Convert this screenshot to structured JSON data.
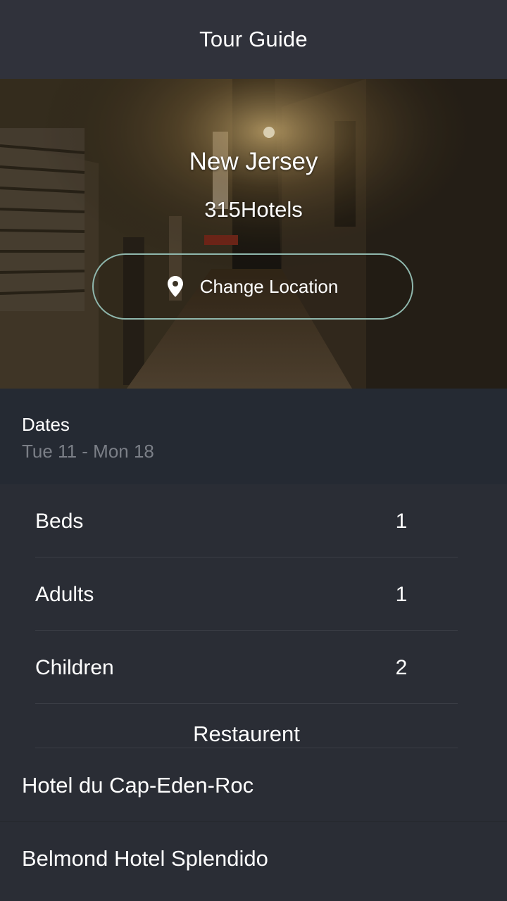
{
  "app_bar": {
    "title": "Tour Guide"
  },
  "hero": {
    "location": "New Jersey",
    "hotel_count": "315Hotels",
    "change_location_label": "Change Location",
    "button_border_color": "#8fb7ad",
    "pin_icon": "map-pin-icon"
  },
  "dates": {
    "label": "Dates",
    "value": "Tue 11 - Mon 18"
  },
  "counters": [
    {
      "label": "Beds",
      "value": "1"
    },
    {
      "label": "Adults",
      "value": "1"
    },
    {
      "label": "Children",
      "value": "2"
    }
  ],
  "section": {
    "title": "Restaurent"
  },
  "hotels": [
    {
      "name": "Hotel du Cap-Eden-Roc"
    },
    {
      "name": "Belmond Hotel Splendido"
    }
  ],
  "colors": {
    "app_bar": "#30323b",
    "background": "#2a2d35",
    "dates_bg": "#252a33",
    "muted_text": "#7b7f87"
  }
}
